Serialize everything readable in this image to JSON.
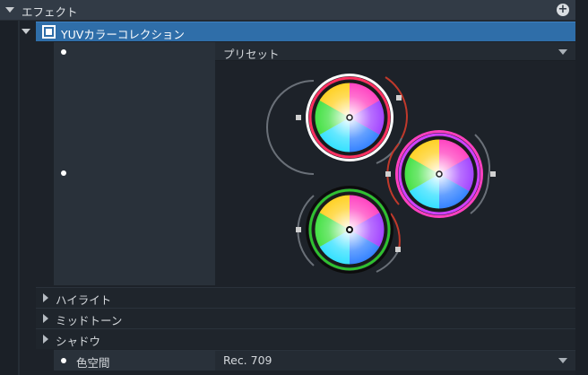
{
  "header": {
    "title": "エフェクト",
    "expand_icon": "triangle-down-icon",
    "add_icon": "plus-circle-icon",
    "add_symbol": "+"
  },
  "effect": {
    "name": "YUVカラーコレクション",
    "enabled": true
  },
  "preset": {
    "value": "プリセット"
  },
  "wheels": {
    "colors": {
      "ring": "#ffffff",
      "accent_red": "#c0392b",
      "handle": "#d0d0d0"
    }
  },
  "sections": [
    {
      "label": "ハイライト"
    },
    {
      "label": "ミッドトーン"
    },
    {
      "label": "シャドウ"
    }
  ],
  "color_space": {
    "label": "色空間",
    "value": "Rec. 709"
  }
}
